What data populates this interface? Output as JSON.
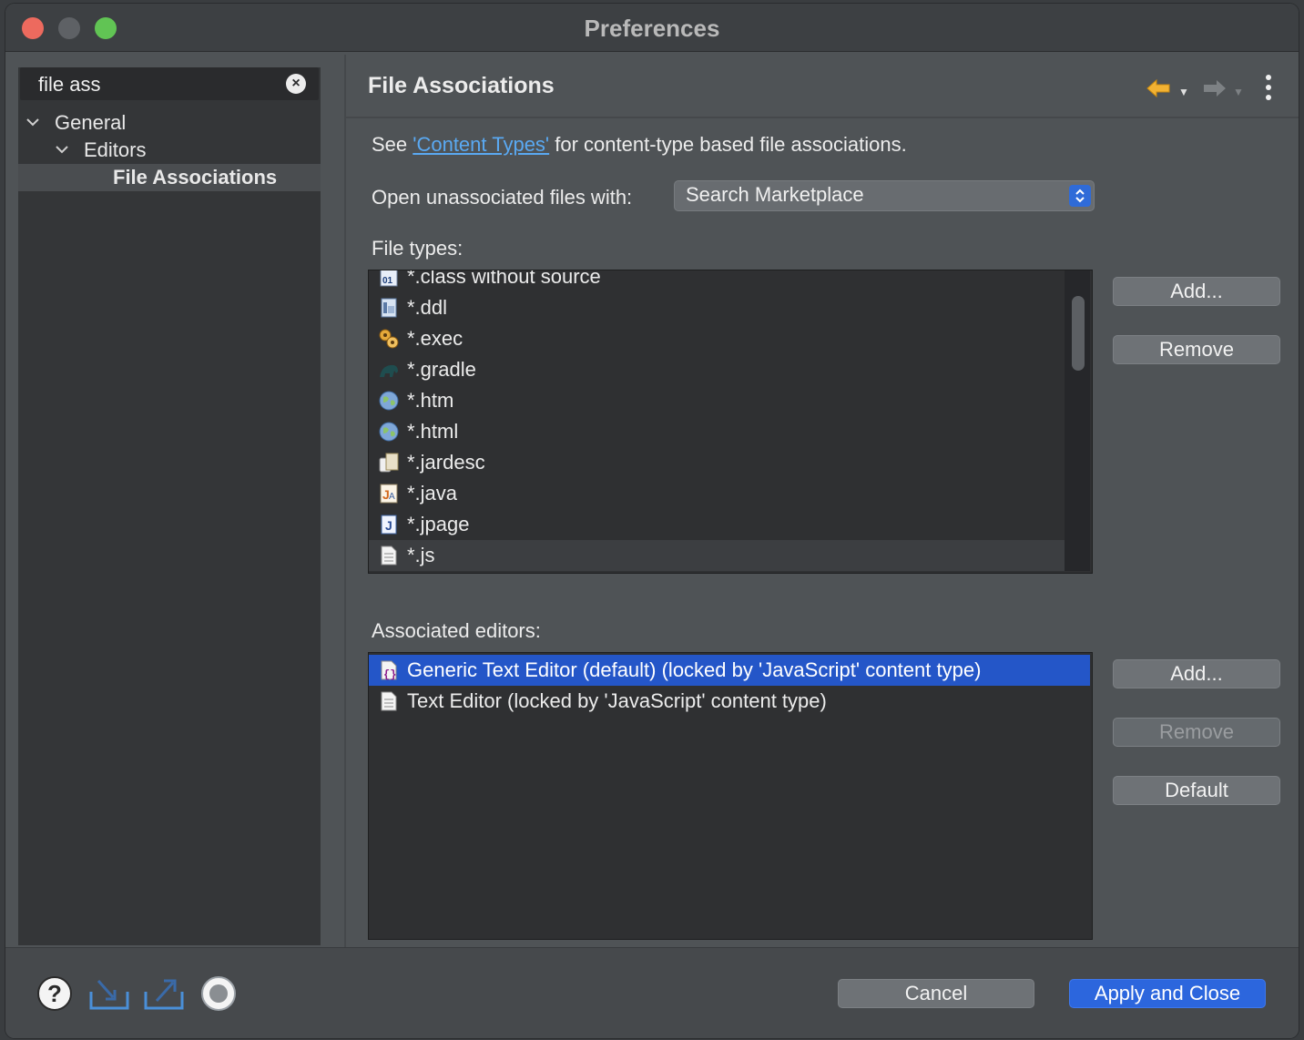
{
  "window": {
    "title": "Preferences"
  },
  "sidebar": {
    "search": {
      "value": "file ass"
    },
    "tree": [
      {
        "label": "General"
      },
      {
        "label": "Editors"
      },
      {
        "label": "File Associations"
      }
    ]
  },
  "page": {
    "title": "File Associations",
    "see_prefix": "See ",
    "see_link": "'Content Types'",
    "see_suffix": " for content-type based file associations.",
    "open_label": "Open unassociated files with:",
    "open_value": "Search Marketplace",
    "file_types_label": "File types:",
    "file_types": [
      {
        "label": "*.class without source",
        "icon": "class-file-icon"
      },
      {
        "label": "*.ddl",
        "icon": "ddl-file-icon"
      },
      {
        "label": "*.exec",
        "icon": "exec-gears-icon"
      },
      {
        "label": "*.gradle",
        "icon": "gradle-elephant-icon"
      },
      {
        "label": "*.htm",
        "icon": "globe-icon"
      },
      {
        "label": "*.html",
        "icon": "globe-icon"
      },
      {
        "label": "*.jardesc",
        "icon": "jar-icon"
      },
      {
        "label": "*.java",
        "icon": "java-file-icon"
      },
      {
        "label": "*.jpage",
        "icon": "jpage-icon"
      },
      {
        "label": "*.js",
        "icon": "text-file-icon"
      }
    ],
    "file_type_buttons": {
      "add": "Add...",
      "remove": "Remove"
    },
    "associated_label": "Associated editors:",
    "associated_editors": [
      {
        "label": "Generic Text Editor (default) (locked by 'JavaScript' content type)",
        "icon": "generic-editor-icon"
      },
      {
        "label": "Text Editor (locked by 'JavaScript' content type)",
        "icon": "text-file-icon"
      }
    ],
    "editor_buttons": {
      "add": "Add...",
      "remove": "Remove",
      "default": "Default"
    }
  },
  "footer": {
    "cancel": "Cancel",
    "apply_close": "Apply and Close"
  }
}
